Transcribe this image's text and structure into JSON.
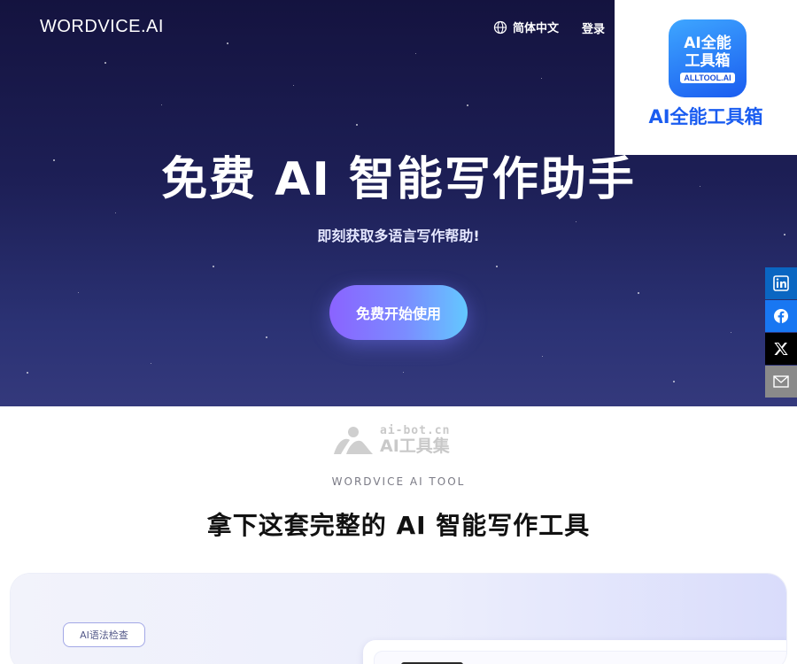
{
  "header": {
    "logo": "WORDVICE.AI",
    "language_label": "简体中文",
    "login_label": "登录"
  },
  "hero": {
    "title": "免费 AI 智能写作助手",
    "subtitle": "即刻获取多语言写作帮助!",
    "cta_label": "免费开始使用"
  },
  "badge": {
    "icon_line1": "AI全能",
    "icon_line2": "工具箱",
    "icon_domain": "ALLTOOL.AI",
    "label": "AI全能工具箱"
  },
  "share": {
    "items": [
      {
        "icon": "linkedin-icon",
        "color": "#0a66c2"
      },
      {
        "icon": "facebook-icon",
        "color": "#1877f2"
      },
      {
        "icon": "x-icon",
        "color": "#000000"
      },
      {
        "icon": "mail-icon",
        "color": "#8a8a8a"
      }
    ]
  },
  "watermark": {
    "domain": "ai-bot.cn",
    "name": "AI工具集"
  },
  "section": {
    "eyebrow": "WORDVICE AI TOOL",
    "title": "拿下这套完整的 AI 智能写作工具"
  },
  "feature_card": {
    "tag_label": "AI语法检查"
  },
  "colors": {
    "hero_bg": "#1d1f56",
    "cta_gradient_start": "#8a63ff",
    "cta_gradient_end": "#63c8ff",
    "badge_blue": "#1a5cf0"
  }
}
